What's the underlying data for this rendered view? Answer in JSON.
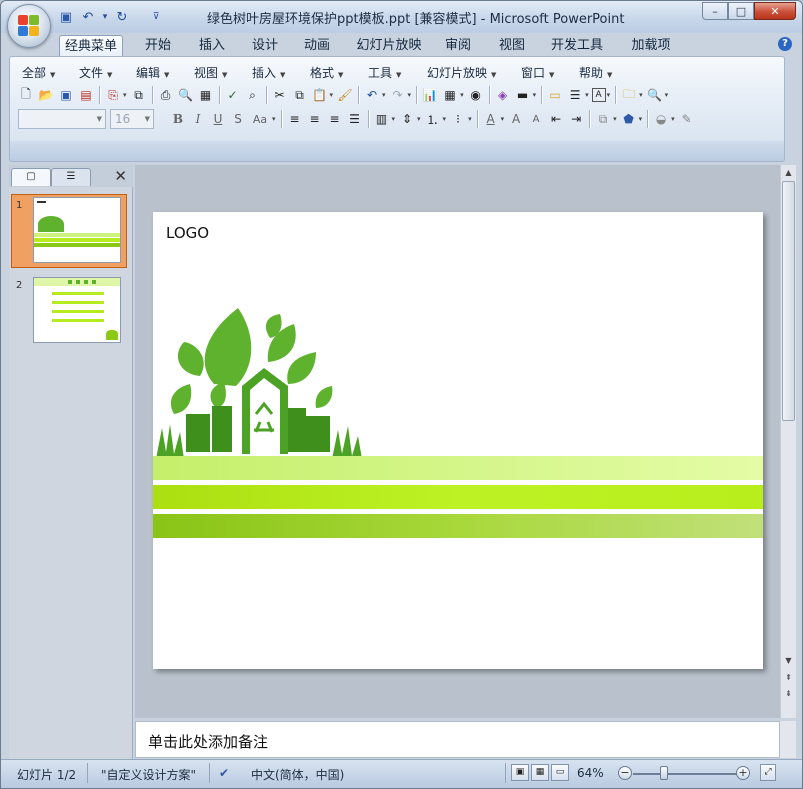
{
  "window": {
    "title": "绿色树叶房屋环境保护ppt模板.ppt [兼容模式] - Microsoft PowerPoint",
    "controls": {
      "minimize": "–",
      "maximize": "□",
      "close": "✕"
    }
  },
  "quick_access": [
    {
      "icon": "save-icon",
      "glyph": "💾"
    },
    {
      "icon": "undo-icon",
      "glyph": "↶"
    },
    {
      "icon": "dropdown-icon",
      "glyph": "▾"
    },
    {
      "icon": "redo-icon",
      "glyph": "↻"
    },
    {
      "icon": "customize-icon",
      "glyph": "⊽"
    }
  ],
  "ribbon_tabs": [
    "经典菜单",
    "开始",
    "插入",
    "设计",
    "动画",
    "幻灯片放映",
    "审阅",
    "视图",
    "开发工具",
    "加载项"
  ],
  "active_tab": "经典菜单",
  "classic_menu": [
    "全部",
    "文件",
    "编辑",
    "视图",
    "插入",
    "格式",
    "工具",
    "幻灯片放映",
    "窗口",
    "帮助"
  ],
  "font": {
    "name": "",
    "size": "16"
  },
  "toolbar_row1_icons": [
    "new-icon",
    "open-icon",
    "save-icon",
    "permission-icon",
    "export-icon",
    "publish-icon",
    "print-icon",
    "print-preview-icon",
    "slide-sorter-icon",
    "spelling-icon",
    "research-icon",
    "cut-icon",
    "copy-icon",
    "paste-icon",
    "format-painter-icon",
    "undo-icon",
    "redo-icon",
    "chart-icon",
    "table-icon",
    "clip-art-icon",
    "color-grayscale-icon",
    "fill-color-icon",
    "new-slide-icon",
    "layout-icon",
    "textbox-icon",
    "folder-icon",
    "zoom-icon"
  ],
  "toolbar_row2_icons": [
    "bold-icon",
    "italic-icon",
    "underline-icon",
    "shadow-icon",
    "change-case-icon",
    "align-left-icon",
    "align-center-icon",
    "align-right-icon",
    "justify-icon",
    "columns-icon",
    "line-spacing-icon",
    "numbering-icon",
    "bullets-icon",
    "font-color-icon",
    "grow-font-icon",
    "shrink-font-icon",
    "decrease-indent-icon",
    "increase-indent-icon",
    "arrange-icon",
    "shapes-icon",
    "shape-fill-icon",
    "shape-outline-icon"
  ],
  "panel_tabs": [
    "slides-tab",
    "outline-tab"
  ],
  "slides": [
    {
      "number": "1",
      "selected": true
    },
    {
      "number": "2",
      "selected": false
    }
  ],
  "slide": {
    "logo": "LOGO",
    "colors": {
      "band1": "#cdf27e",
      "band2": "#b6ec1e",
      "band3": "#8cc916",
      "leaf": "#5fb22e",
      "leaf_dark": "#3f8f1d"
    }
  },
  "notes": {
    "placeholder": "单击此处添加备注"
  },
  "status": {
    "slide_counter": "幻灯片 1/2",
    "theme": "\"自定义设计方案\"",
    "language": "中文(简体，中国)",
    "zoom": "64%",
    "zoom_fraction": 0.64
  }
}
